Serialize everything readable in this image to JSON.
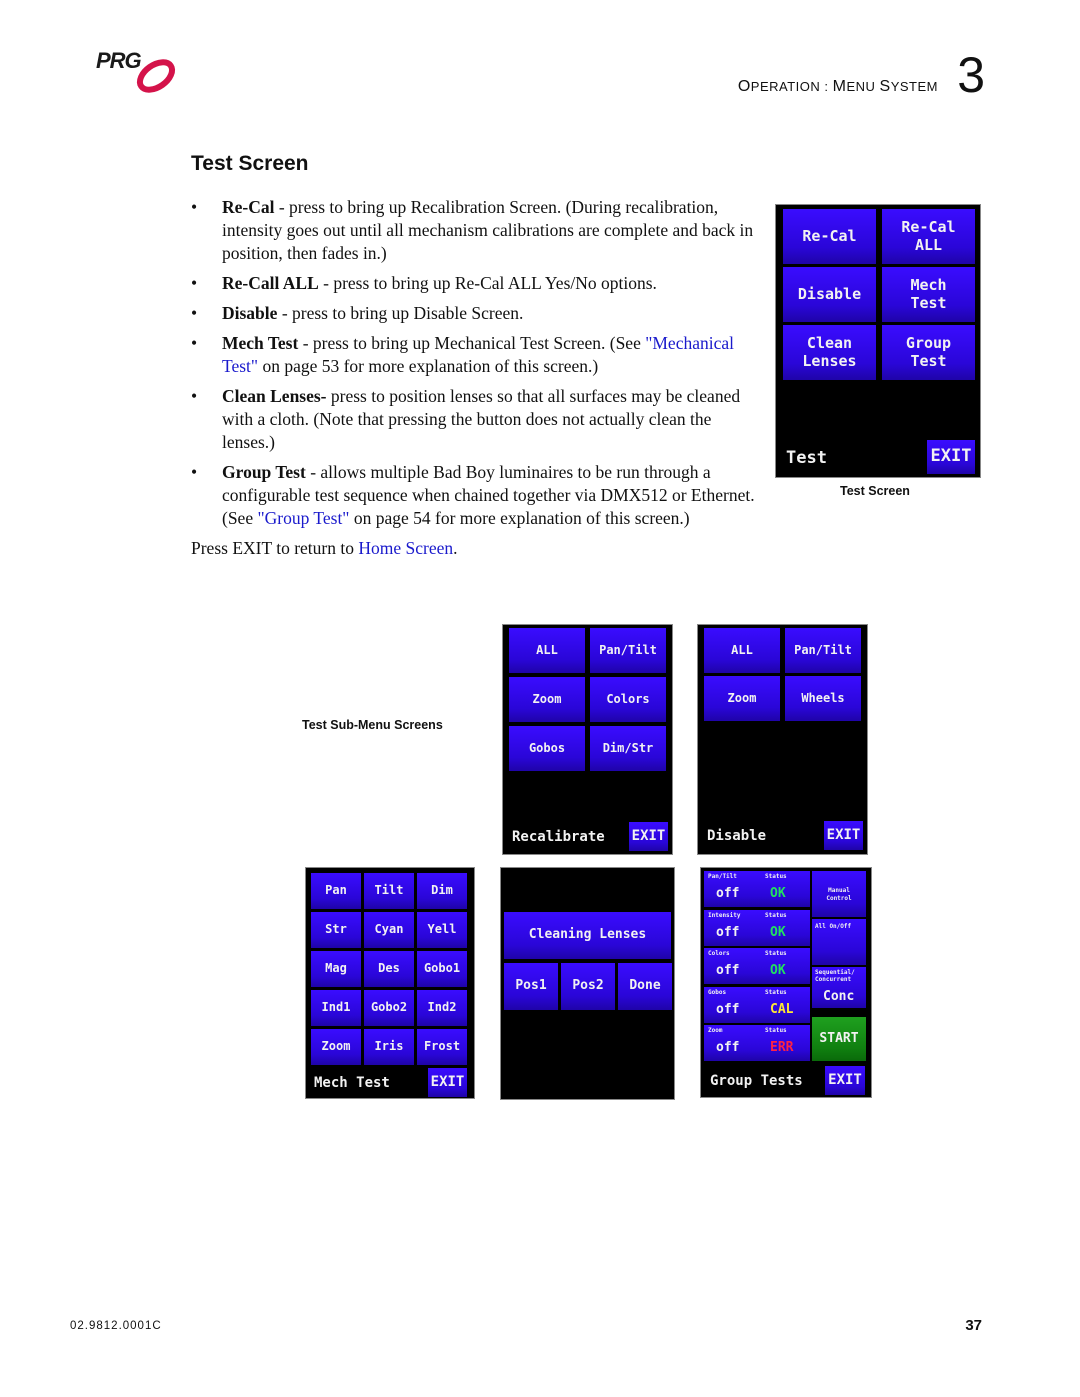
{
  "header": {
    "logo_text": "PRG",
    "section_prefix_cap": "O",
    "section_prefix_rest": "PERATION",
    "section_sep": " : ",
    "section_word1_cap": "M",
    "section_word1_rest": "ENU",
    "section_word2_cap": "S",
    "section_word2_rest": "YSTEM",
    "chapter_number": "3"
  },
  "section": {
    "title": "Test Screen"
  },
  "bullets": [
    {
      "term": "Re-Cal",
      "text": " - press to bring up Recalibration Screen. (During recalibration, intensity goes out until all mechanism calibrations are complete and back in position, then fades in.)"
    },
    {
      "term": "Re-Call ALL",
      "text": " - press to bring up Re-Cal ALL Yes/No options."
    },
    {
      "term": "Disable",
      "text": " - press to bring up Disable Screen."
    },
    {
      "term": "Mech Test",
      "text_before": " - press to bring up Mechanical Test Screen. (See ",
      "link": "\"Mechanical Test\"",
      "text_after": " on page 53 for more explanation of this screen.)"
    },
    {
      "term": "Clean Lenses-",
      "text": " press to position lenses so that all surfaces may be cleaned with a cloth. (Note that pressing the button does not actually clean the lenses.)"
    },
    {
      "term": "Group Test",
      "text_before": " - allows multiple Bad Boy luminaires to be run through a configurable test sequence when chained together via DMX512 or Ethernet. (See ",
      "link": "\"Group Test\"",
      "text_after": " on page 54 for more explanation of this screen.)"
    }
  ],
  "press_exit": {
    "text_before": "Press EXIT to return to ",
    "link": "Home Screen",
    "text_after": "."
  },
  "captions": {
    "test_screen": "Test Screen",
    "sub_menu": "Test Sub-Menu Screens"
  },
  "test_screen": {
    "buttons": [
      "Re-Cal",
      "Re-Cal ALL",
      "Disable",
      "Mech Test",
      "Clean Lenses",
      "Group Test"
    ],
    "label": "Test",
    "exit": "EXIT"
  },
  "recalibrate_screen": {
    "buttons": [
      "ALL",
      "Pan/Tilt",
      "Zoom",
      "Colors",
      "Gobos",
      "Dim/Str"
    ],
    "label": "Recalibrate",
    "exit": "EXIT"
  },
  "disable_screen": {
    "buttons": [
      "ALL",
      "Pan/Tilt",
      "Zoom",
      "Wheels"
    ],
    "label": "Disable",
    "exit": "EXIT"
  },
  "mech_test_screen": {
    "buttons": [
      "Pan",
      "Tilt",
      "Dim",
      "Str",
      "Cyan",
      "Yell",
      "Mag",
      "Des",
      "Gobo1",
      "Ind1",
      "Gobo2",
      "Ind2",
      "Zoom",
      "Iris",
      "Frost"
    ],
    "label": "Mech Test",
    "exit": "EXIT"
  },
  "cleaning_screen": {
    "title_button": "Cleaning Lenses",
    "buttons": [
      "Pos1",
      "Pos2",
      "Done"
    ]
  },
  "group_tests_screen": {
    "rows": [
      {
        "name": "Pan/Tilt",
        "status_label": "Status",
        "value": "off",
        "status": "OK"
      },
      {
        "name": "Intensity",
        "status_label": "Status",
        "value": "off",
        "status": "OK"
      },
      {
        "name": "Colors",
        "status_label": "Status",
        "value": "off",
        "status": "OK"
      },
      {
        "name": "Gobos",
        "status_label": "Status",
        "value": "off",
        "status": "CAL"
      },
      {
        "name": "Zoom",
        "status_label": "Status",
        "value": "off",
        "status": "ERR"
      }
    ],
    "manual_control": "Manual Control",
    "all_on_off": "All On/Off",
    "seq_conc_label": "Sequential/ Concurrent",
    "seq_conc_value": "Conc",
    "start": "START",
    "label": "Group Tests",
    "exit": "EXIT",
    "status_colors": {
      "OK": "#22e060",
      "CAL": "#ffe833",
      "ERR": "#ff2244"
    }
  },
  "footer": {
    "doc_number": "02.9812.0001C",
    "page_number": "37"
  }
}
